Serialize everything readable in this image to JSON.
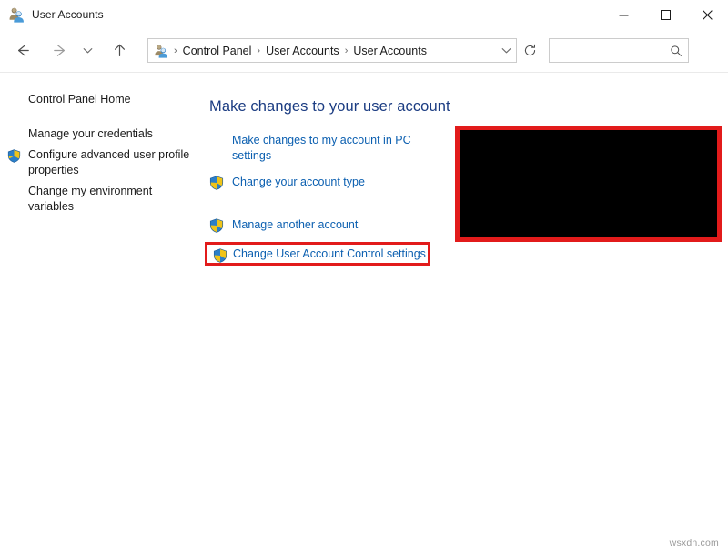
{
  "window": {
    "title": "User Accounts",
    "icon": "user-accounts-icon",
    "minimize_label": "Minimize",
    "maximize_label": "Maximize",
    "close_label": "Close"
  },
  "toolbar": {
    "back_label": "Back",
    "forward_label": "Forward",
    "recent_label": "Recent locations",
    "up_label": "Up",
    "refresh_label": "Refresh",
    "address_icon": "user-accounts-icon",
    "breadcrumb": [
      "Control Panel",
      "User Accounts",
      "User Accounts"
    ],
    "breadcrumb_separator": "›",
    "dropdown_label": "Previous locations"
  },
  "search": {
    "value": "",
    "placeholder": "",
    "icon": "search-icon"
  },
  "help": {
    "label": "?",
    "tooltip": "Help",
    "color": "#1f7fd4"
  },
  "sidebar": {
    "home_label": "Control Panel Home",
    "items": [
      {
        "label": "Manage your credentials",
        "shield": false
      },
      {
        "label": "Configure advanced user profile properties",
        "shield": true
      },
      {
        "label": "Change my environment variables",
        "shield": false
      }
    ]
  },
  "main": {
    "heading": "Make changes to your user account",
    "links": [
      {
        "label": "Make changes to my account in PC settings",
        "shield": false,
        "highlighted": false
      },
      {
        "label": "Change your account type",
        "shield": true,
        "highlighted": false
      },
      {
        "label": "Manage another account",
        "shield": true,
        "highlighted": false
      },
      {
        "label": "Change User Account Control settings",
        "shield": true,
        "highlighted": true
      }
    ]
  },
  "annotation": {
    "highlight_color": "#e21b1b",
    "redacted_box": {
      "fill": "#000000",
      "border": "#e21b1b"
    }
  },
  "watermark": {
    "text": "wsxdn.com"
  },
  "colors": {
    "heading": "#1b3c82",
    "link": "#0b5fb0",
    "text": "#1b1b1b",
    "border": "#cccccc"
  }
}
